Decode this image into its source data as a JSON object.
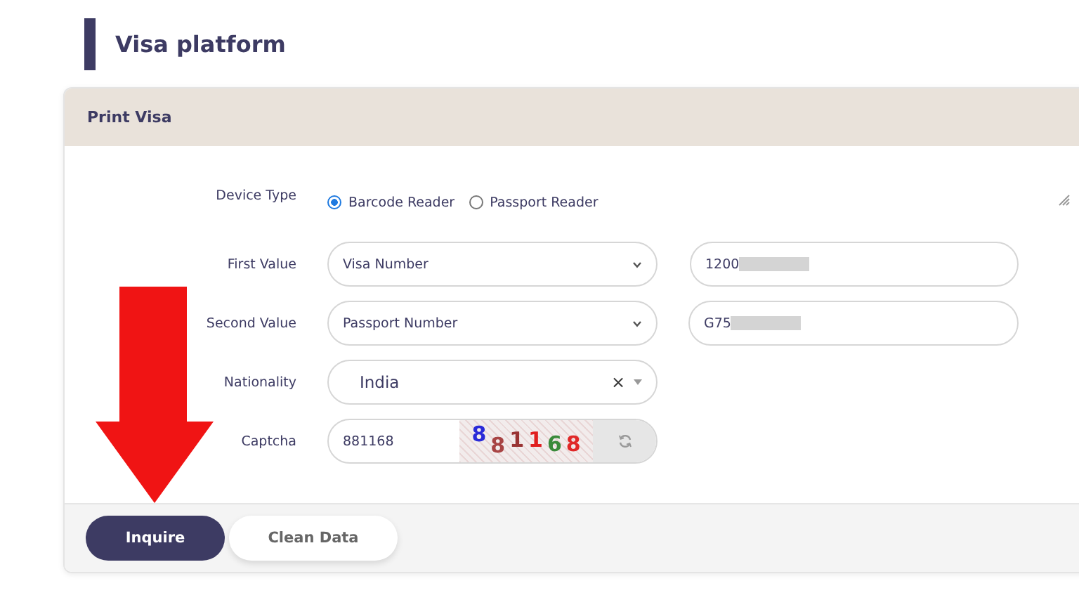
{
  "page_title": "Visa platform",
  "card": {
    "title": "Print Visa"
  },
  "device_type": {
    "label": "Device Type",
    "options": [
      {
        "label": "Barcode Reader",
        "selected": true
      },
      {
        "label": "Passport Reader",
        "selected": false
      }
    ]
  },
  "rows": [
    {
      "kind": "select_input",
      "label": "First Value",
      "select": "Visa Number",
      "input": "1200",
      "redacted": true
    },
    {
      "kind": "select_input",
      "label": "Second Value",
      "select": "Passport Number",
      "input": "G75",
      "redacted": true
    },
    {
      "kind": "combo",
      "label": "Nationality",
      "value": "India",
      "clear": "×"
    },
    {
      "kind": "captcha",
      "label": "Captcha",
      "value": "881168",
      "captcha": [
        {
          "char": "8",
          "color": "#2a2ad8"
        },
        {
          "char": "8",
          "color": "#a84444"
        },
        {
          "char": "1",
          "color": "#993333"
        },
        {
          "char": "1",
          "color": "#e02020"
        },
        {
          "char": "6",
          "color": "#3a8a3a"
        },
        {
          "char": "8",
          "color": "#e02828"
        }
      ]
    }
  ],
  "buttons": [
    {
      "label": "Inquire",
      "kind": "primary"
    },
    {
      "label": "Clean Data",
      "kind": "secondary"
    }
  ]
}
